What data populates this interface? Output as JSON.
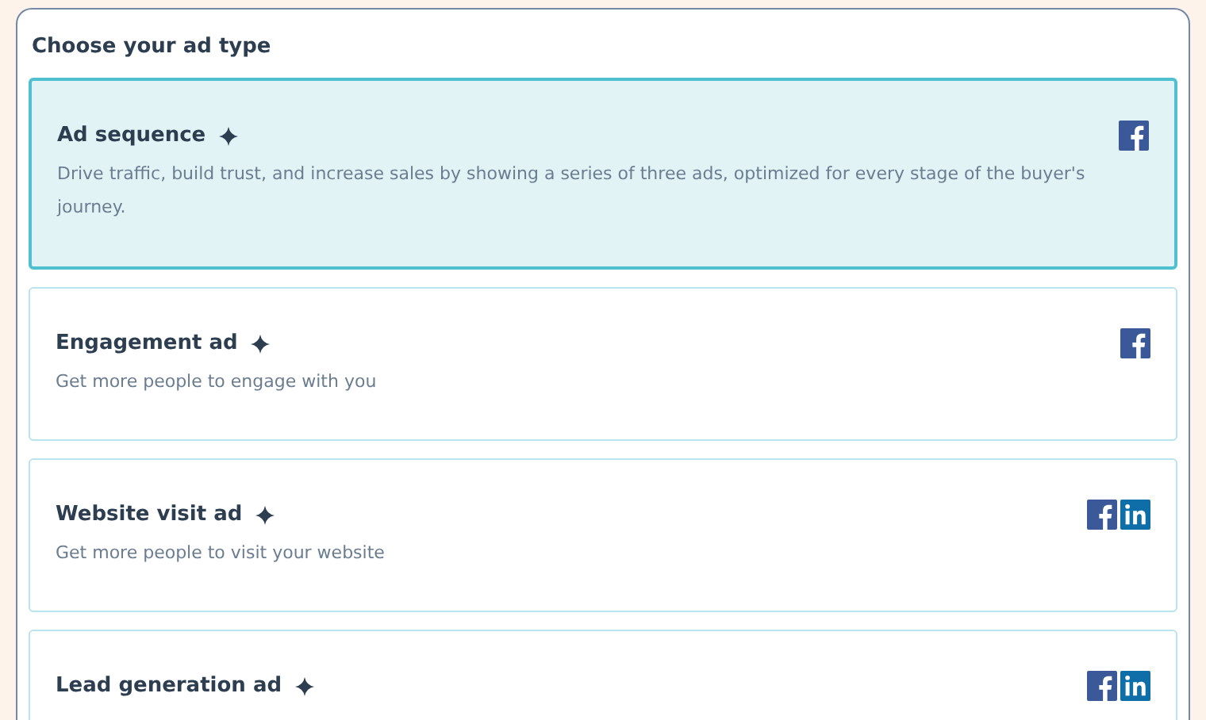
{
  "title": "Choose your ad type",
  "ad_types": [
    {
      "name": "Ad sequence",
      "description": "Drive traffic, build trust, and increase sales by showing a series of three ads, optimized for every stage of the buyer's journey.",
      "selected": true,
      "platforms": [
        {
          "kind": "facebook"
        }
      ]
    },
    {
      "name": "Engagement ad",
      "description": "Get more people to engage with you",
      "selected": false,
      "platforms": [
        {
          "kind": "facebook"
        }
      ]
    },
    {
      "name": "Website visit ad",
      "description": "Get more people to visit your website",
      "selected": false,
      "platforms": [
        {
          "kind": "facebook"
        },
        {
          "kind": "linkedin"
        }
      ]
    },
    {
      "name": "Lead generation ad",
      "selected": false,
      "platforms": [
        {
          "kind": "facebook"
        },
        {
          "kind": "linkedin"
        }
      ]
    }
  ]
}
